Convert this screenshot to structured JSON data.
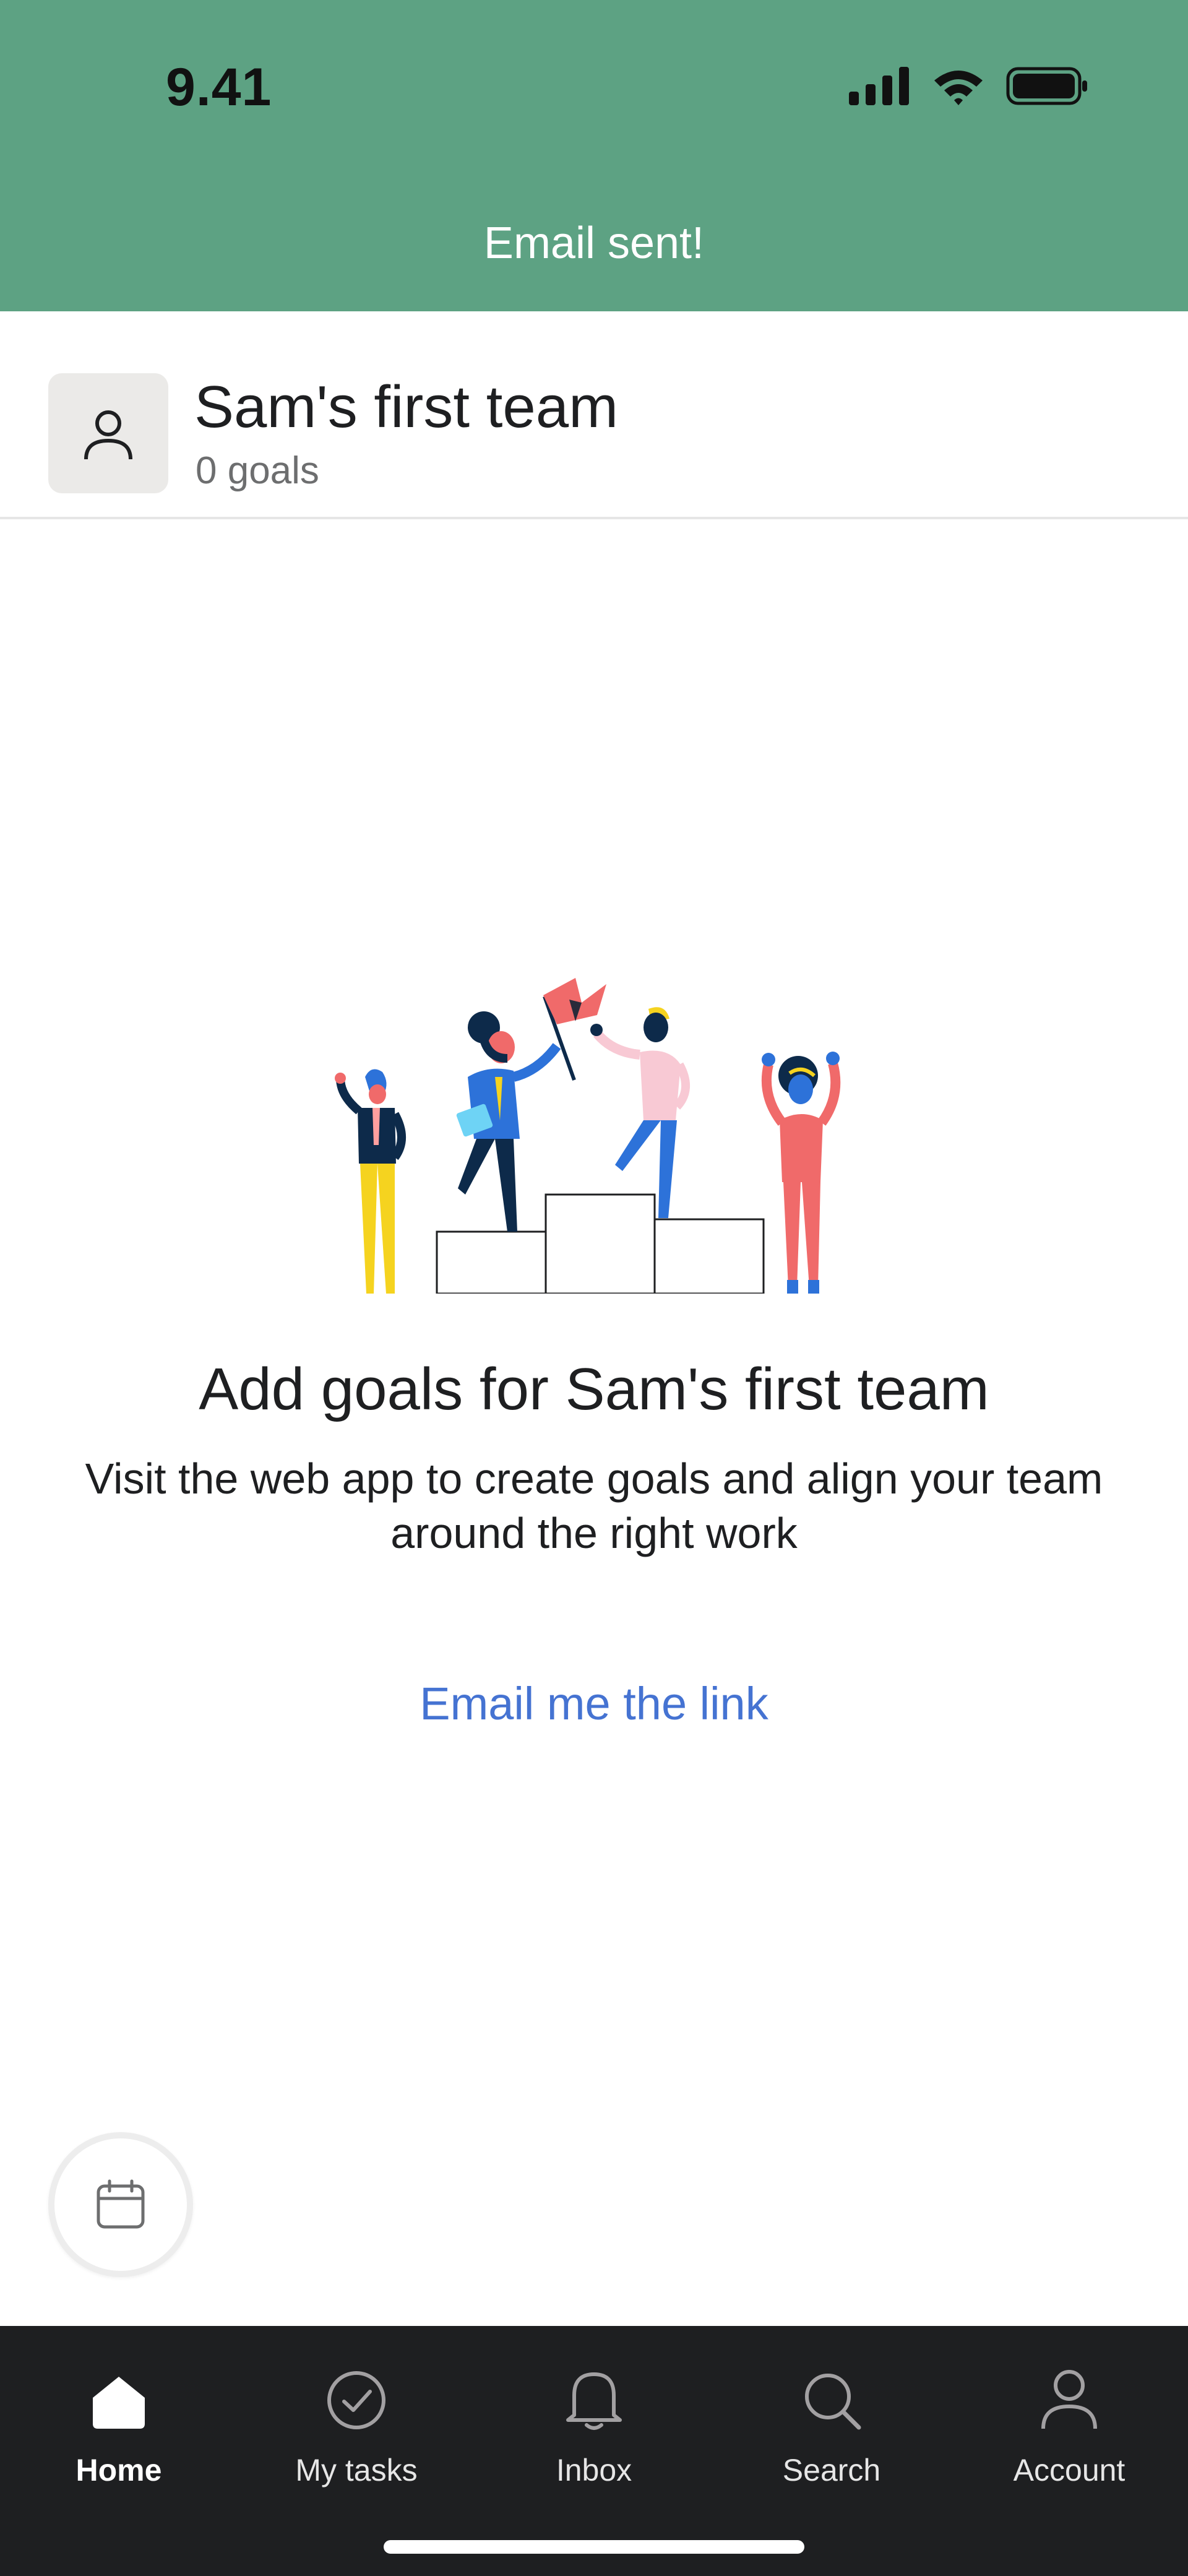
{
  "status_bar": {
    "time": "9.41"
  },
  "toast": {
    "message": "Email sent!"
  },
  "team": {
    "name": "Sam's first team",
    "goals_count": "0 goals"
  },
  "empty_state": {
    "title": "Add goals for Sam's first team",
    "description": "Visit the web app to create goals and align your team around the right work",
    "link_label": "Email me the link"
  },
  "fab": {
    "icon": "calendar-icon"
  },
  "tabs": [
    {
      "label": "Home",
      "icon": "home-icon",
      "active": true
    },
    {
      "label": "My tasks",
      "icon": "check-circle-icon",
      "active": false
    },
    {
      "label": "Inbox",
      "icon": "bell-icon",
      "active": false
    },
    {
      "label": "Search",
      "icon": "search-icon",
      "active": false
    },
    {
      "label": "Account",
      "icon": "person-icon",
      "active": false
    }
  ],
  "colors": {
    "banner": "#5da283",
    "link": "#4573d2",
    "tabbar": "#1e1f21"
  }
}
